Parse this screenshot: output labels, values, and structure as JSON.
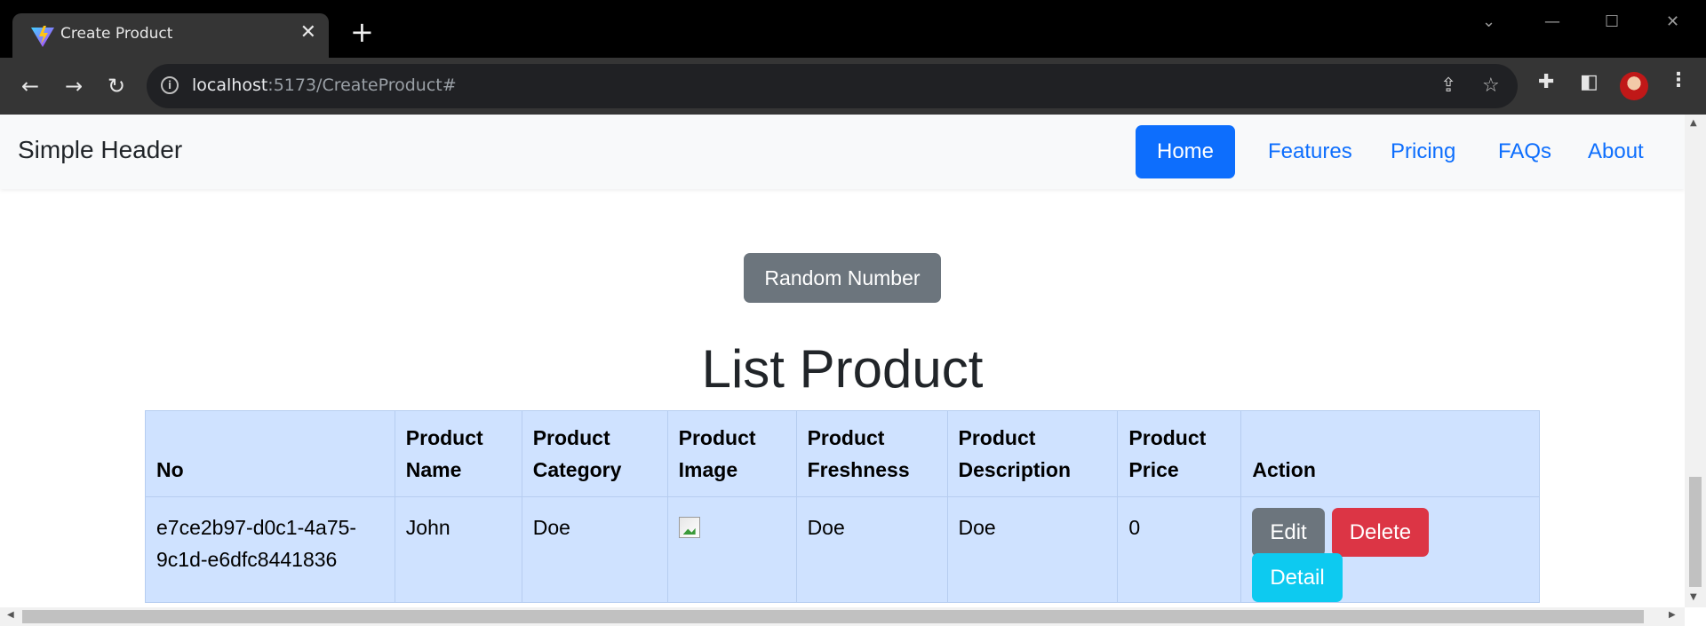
{
  "browser": {
    "tab_title": "Create Product",
    "url_host": "localhost",
    "url_rest": ":5173/CreateProduct#"
  },
  "navbar": {
    "brand": "Simple Header",
    "links": [
      "Home",
      "Features",
      "Pricing",
      "FAQs",
      "About"
    ],
    "active": "Home"
  },
  "main": {
    "random_button": "Random Number",
    "title": "List Product"
  },
  "table": {
    "headers": [
      "No",
      "Product Name",
      "Product Category",
      "Product Image",
      "Product Freshness",
      "Product Description",
      "Product Price",
      "Action"
    ],
    "rows": [
      {
        "no": "e7ce2b97-d0c1-4a75-9c1d-e6dfc8441836",
        "name": "John",
        "category": "Doe",
        "freshness": "Doe",
        "description": "Doe",
        "price": "0"
      }
    ],
    "actions": {
      "edit": "Edit",
      "delete": "Delete",
      "detail": "Detail"
    }
  },
  "colors": {
    "primary": "#0d6efd",
    "secondary": "#6c757d",
    "danger": "#dc3545",
    "info": "#0dcaf0",
    "table_bg": "#cfe2ff"
  },
  "icons": [
    "vite-favicon-icon",
    "close-icon",
    "plus-icon",
    "back-arrow-icon",
    "forward-arrow-icon",
    "reload-icon",
    "info-icon",
    "share-icon",
    "star-icon",
    "puzzle-icon",
    "side-panel-icon",
    "avatar",
    "kebab-menu-icon"
  ]
}
